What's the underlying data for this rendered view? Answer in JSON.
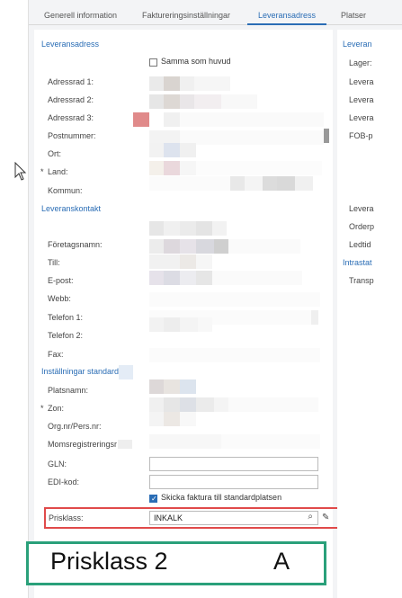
{
  "tabs": [
    {
      "label": "Generell information"
    },
    {
      "label": "Faktureringsinställningar"
    },
    {
      "label": "Leveransadress"
    },
    {
      "label": "Platser"
    }
  ],
  "sections": {
    "address": "Leveransadress",
    "contact": "Leveranskontakt",
    "settings": "Inställningar standard"
  },
  "same_as_main": "Samma som huvud",
  "address_fields": [
    "Adressrad 1:",
    "Adressrad 2:",
    "Adressrad 3:",
    "Postnummer:",
    "Ort:",
    "Land:",
    "Kommun:"
  ],
  "contact_fields": [
    "Företagsnamn:",
    "Till:",
    "E-post:",
    "Webb:",
    "Telefon 1:",
    "Telefon 2:",
    "Fax:"
  ],
  "settings_fields": [
    "Platsnamn:",
    "Zon:",
    "Org.nr/Pers.nr:",
    "Momsregistreringsr",
    "GLN:",
    "EDI-kod:"
  ],
  "send_invoice": "Skicka faktura till standardplatsen",
  "price_class": {
    "label": "Prisklass:",
    "value": "INKALK"
  },
  "annotation": {
    "left": "Prisklass 2",
    "right": "A"
  },
  "right_column": {
    "section1": "Leveran",
    "rows1": [
      "Lager:",
      "Levera",
      "Levera",
      "Levera",
      "FOB-p"
    ],
    "rows2": [
      "Levera",
      "Orderp",
      "Ledtid"
    ],
    "section2": "Intrastat",
    "rows3": [
      "Transp"
    ]
  },
  "colors": {
    "accent": "#2a6db5",
    "highlight_red": "#e04a4a",
    "highlight_green": "#2aa07a"
  }
}
